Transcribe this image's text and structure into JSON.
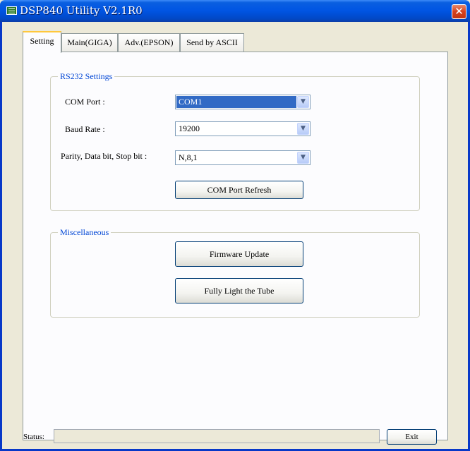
{
  "window": {
    "title": "DSP840 Utility V2.1R0",
    "close_symbol": "✕"
  },
  "tabs": [
    {
      "label": "Setting",
      "active": true
    },
    {
      "label": "Main(GIGA)",
      "active": false
    },
    {
      "label": "Adv.(EPSON)",
      "active": false
    },
    {
      "label": "Send by ASCII",
      "active": false
    }
  ],
  "rs232": {
    "group_label": "RS232 Settings",
    "com_port_label": "COM Port :",
    "com_port_value": "COM1",
    "baud_rate_label": "Baud Rate :",
    "baud_rate_value": "19200",
    "parity_label": "Parity, Data bit, Stop bit :",
    "parity_value": "N,8,1",
    "refresh_button": "COM Port Refresh"
  },
  "misc": {
    "group_label": "Miscellaneous",
    "firmware_button": "Firmware Update",
    "light_button": "Fully Light the Tube"
  },
  "status": {
    "label": "Status:",
    "value": "",
    "exit_button": "Exit"
  },
  "icons": {
    "app": "app-icon",
    "dropdown": "chevron-down-icon"
  },
  "colors": {
    "titlebar": "#0054e3",
    "group_label": "#0046d5",
    "selection": "#316ac5",
    "active_tab_accent": "#ffc83c"
  }
}
